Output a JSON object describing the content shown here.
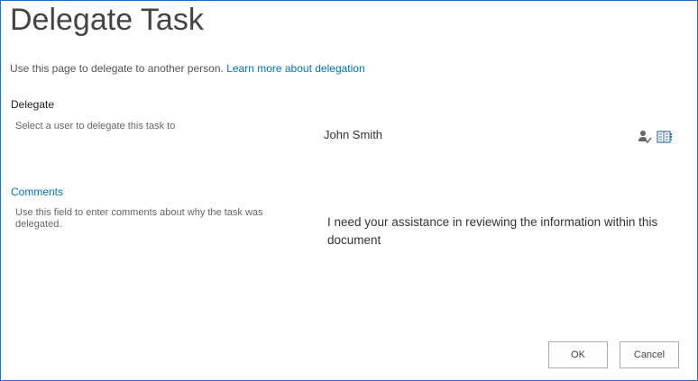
{
  "title": "Delegate Task",
  "intro": {
    "text": "Use this page to delegate to another person.",
    "link": "Learn more about delegation"
  },
  "delegate": {
    "label": "Delegate",
    "description": "Select a user to delegate this task to",
    "value": "John Smith",
    "icons": [
      "check-names-icon",
      "browse-address-book-icon"
    ]
  },
  "comments": {
    "label": "Comments",
    "description": "Use this field to enter comments about why the task was delegated.",
    "value": "I need your assistance in reviewing the information within this document"
  },
  "buttons": {
    "ok": "OK",
    "cancel": "Cancel"
  },
  "colors": {
    "accent": "#0072c6",
    "border": "#1a73c8"
  }
}
